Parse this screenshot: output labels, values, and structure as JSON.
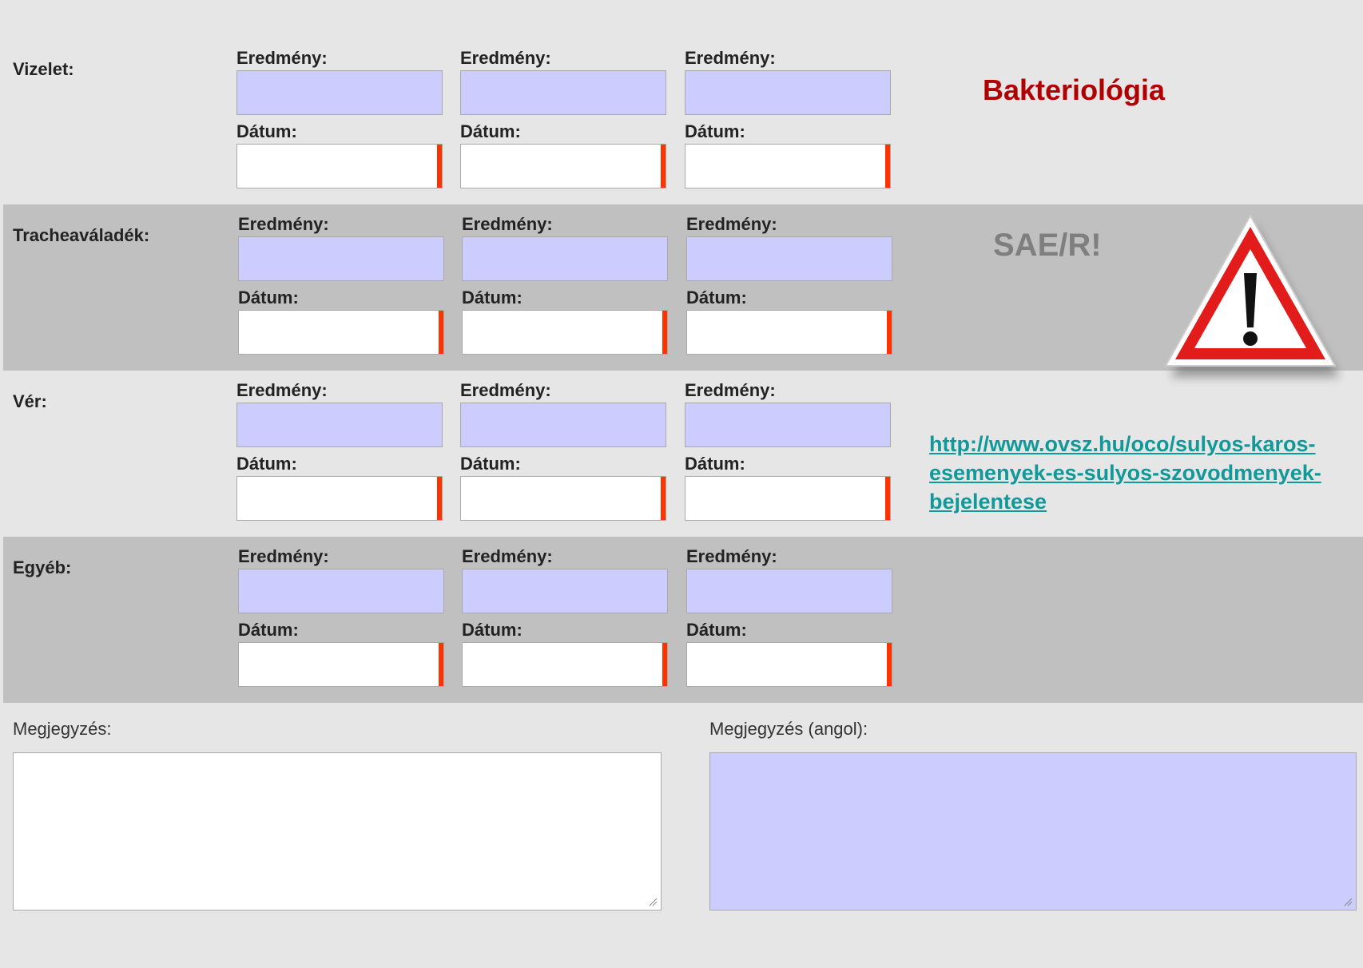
{
  "sections": [
    {
      "label": "Vizelet:"
    },
    {
      "label": "Tracheaváladék:"
    },
    {
      "label": "Vér:"
    },
    {
      "label": "Egyéb:"
    }
  ],
  "fields": {
    "result_label": "Eredmény:",
    "date_label": "Dátum:",
    "result_value": "",
    "date_value": ""
  },
  "side": {
    "title": "Bakteriológia",
    "sae": "SAE/R!",
    "warning_icon": "warning-triangle-icon",
    "link": "http://www.ovsz.hu/oco/sulyos-karos-esemenyek-es-sulyos-szovodmenyek-bejelentese"
  },
  "notes": {
    "left_label": "Megjegyzés:",
    "right_label": "Megjegyzés (angol):",
    "left_value": "",
    "right_value": ""
  },
  "colors": {
    "result_bg": "#ccccff",
    "date_marker": "#ff3300",
    "title_color": "#b00000",
    "link_color": "#119999",
    "row_dark": "#c0c0c0",
    "row_light": "#e6e6e6"
  }
}
